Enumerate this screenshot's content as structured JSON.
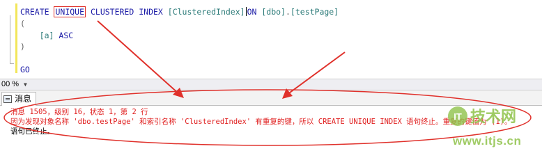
{
  "editor": {
    "line1": {
      "kw_create": "CREATE",
      "kw_unique": "UNIQUE",
      "kw_clustered": "CLUSTERED",
      "kw_index": "INDEX",
      "index_name": "[ClusteredIndex]",
      "kw_on": "ON",
      "schema": "[dbo]",
      "dot": ".",
      "table": "[testPage]"
    },
    "line2": "(",
    "line3": {
      "column": "[a]",
      "order": "ASC"
    },
    "line4": ")",
    "line6": "GO"
  },
  "statusbar": {
    "zoom": "00 %"
  },
  "results": {
    "tab_label": "消息",
    "messages": [
      "消息 1505，级别 16，状态 1，第 2 行",
      "因为发现对象名称 'dbo.testPage' 和索引名称 'ClusteredIndex' 有重复的键，所以 CREATE UNIQUE INDEX 语句终止。重复的键值为 (1)。",
      "语句已终止。"
    ]
  },
  "watermark": {
    "logo_text": "技术网",
    "url": "www.itjs.cn"
  },
  "colors": {
    "annotation": "#e0312b",
    "error_text": "#e02020",
    "keyword": "#1a1aa6",
    "watermark": "#8fc24a"
  }
}
